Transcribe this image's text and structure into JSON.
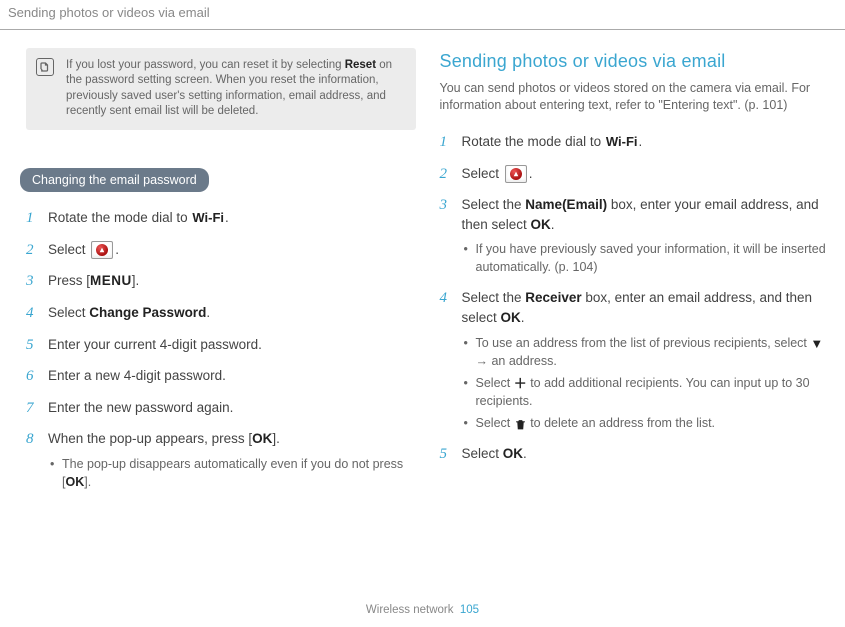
{
  "header": {
    "title": "Sending photos or videos via email"
  },
  "left": {
    "note": {
      "text_before": "If you lost your password, you can reset it by selecting ",
      "bold": "Reset",
      "text_after": " on the password setting screen. When you reset the information, previously saved user's setting information, email address, and recently sent email list will be deleted."
    },
    "pill": "Changing the email password",
    "steps": {
      "s1a": "Rotate the mode dial to ",
      "s1_wifi": "Wi-Fi",
      "s1b": ".",
      "s2a": "Select ",
      "s2b": ".",
      "s3a": "Press [",
      "s3_menu": "MENU",
      "s3b": "].",
      "s4a": "Select ",
      "s4_bold": "Change Password",
      "s4b": ".",
      "s5": "Enter your current 4-digit password.",
      "s6": "Enter a new 4-digit password.",
      "s7": "Enter the new password again.",
      "s8a": "When the pop-up appears, press [",
      "s8_ok": "OK",
      "s8b": "].",
      "s8_sub_a": "The pop-up disappears automatically even if you do not press [",
      "s8_sub_ok": "OK",
      "s8_sub_b": "]."
    }
  },
  "right": {
    "heading": "Sending photos or videos via email",
    "intro": "You can send photos or videos stored on the camera via email. For information about entering text, refer to \"Entering text\". (p. 101)",
    "steps": {
      "s1a": "Rotate the mode dial to ",
      "s1_wifi": "Wi-Fi",
      "s1b": ".",
      "s2a": "Select ",
      "s2b": ".",
      "s3a": "Select the ",
      "s3_bold": "Name(Email)",
      "s3b": " box, enter your email address, and then select ",
      "s3_ok": "OK",
      "s3c": ".",
      "s3_sub1": "If you have previously saved your information, it will be inserted automatically. (p. 104)",
      "s4a": "Select the ",
      "s4_bold": "Receiver",
      "s4b": " box, enter an email address, and then select ",
      "s4_ok": "OK",
      "s4c": ".",
      "s4_sub1a": "To use an address from the list of previous recipients, select ",
      "s4_sub1b": " → an address.",
      "s4_sub2a": "Select ",
      "s4_sub2b": " to add additional recipients. You can input up to 30 recipients.",
      "s4_sub3a": "Select ",
      "s4_sub3b": " to delete an address from the list.",
      "s5a": "Select ",
      "s5_ok": "OK",
      "s5b": "."
    }
  },
  "footer": {
    "label": "Wireless network",
    "page": "105"
  }
}
